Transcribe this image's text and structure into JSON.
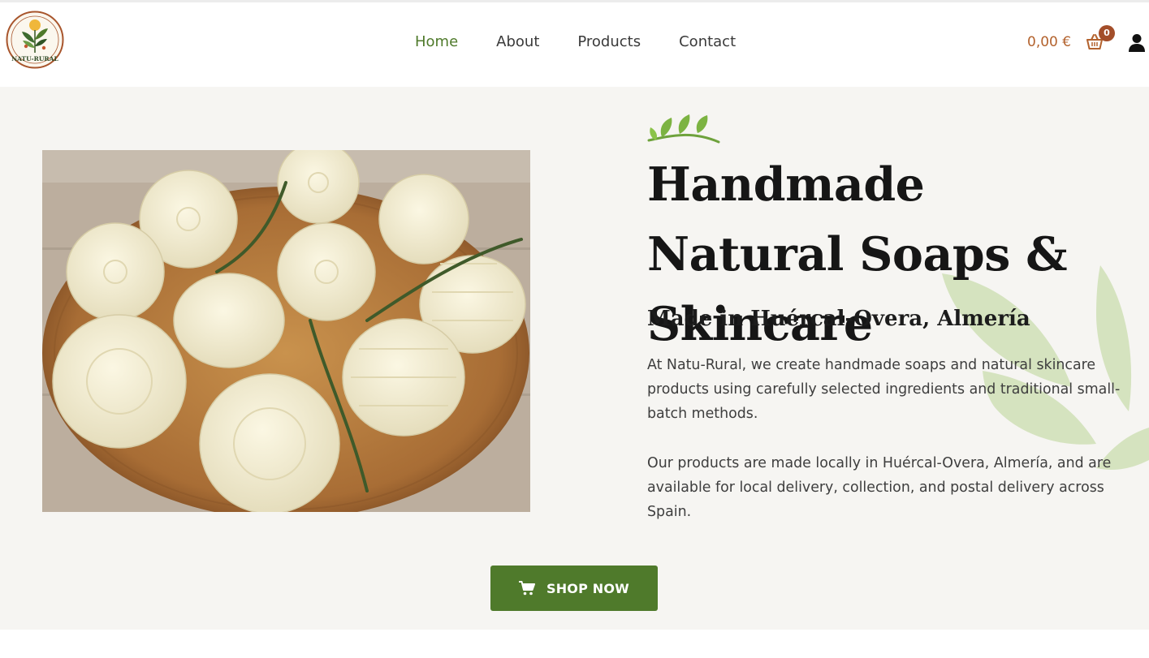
{
  "brand": {
    "logo_text": "NATU-RURAL",
    "logo_icon": "leaf-wreath-logo"
  },
  "nav": {
    "items": [
      {
        "label": "Home",
        "active": true
      },
      {
        "label": "About",
        "active": false
      },
      {
        "label": "Products",
        "active": false
      },
      {
        "label": "Contact",
        "active": false
      }
    ]
  },
  "header_actions": {
    "cart_total": "0,00 €",
    "cart_count": "0",
    "cart_icon": "basket-icon",
    "account_icon": "user-icon"
  },
  "hero": {
    "title": "Handmade Natural Soaps & Skincare",
    "subtitle": "Made in Huércal-Overa, Almería",
    "paragraph_1": "At Natu-Rural, we create handmade soaps and natural skincare products using carefully selected ingredients and traditional small-batch methods.",
    "paragraph_2": "Our products are made locally in Huércal-Overa, Almería, and are available for local delivery, collection, and postal delivery across Spain.",
    "image_icon": "soap-bars-photo",
    "cta": {
      "label": "SHOP NOW",
      "icon": "shopping-cart-icon"
    }
  },
  "colors": {
    "accent_green": "#4f7a2b",
    "cart_brown": "#b3622d",
    "badge_brown": "#a34e2a",
    "hero_background": "#f6f5f2",
    "leaf_light": "#c9dcae"
  }
}
